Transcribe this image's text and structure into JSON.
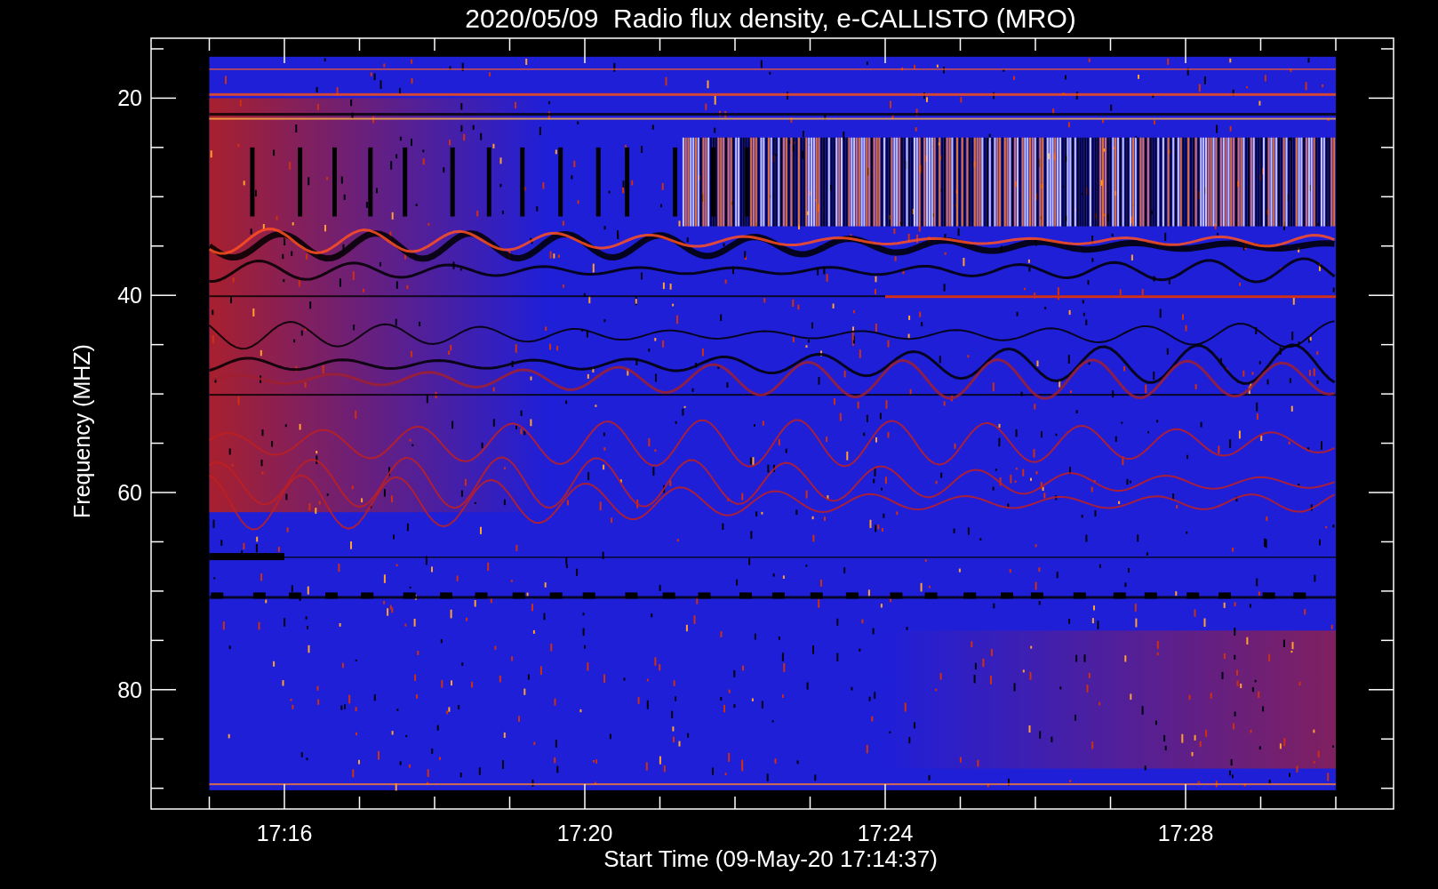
{
  "title": "2020/05/09  Radio flux density, e-CALLISTO (MRO)",
  "y_axis": {
    "label": "Frequency (MHZ)",
    "ticks": [
      "20",
      "40",
      "60",
      "80"
    ]
  },
  "x_axis": {
    "label": "Start Time (09-May-20 17:14:37)",
    "ticks": [
      "17:16",
      "17:20",
      "17:24",
      "17:28"
    ]
  }
}
